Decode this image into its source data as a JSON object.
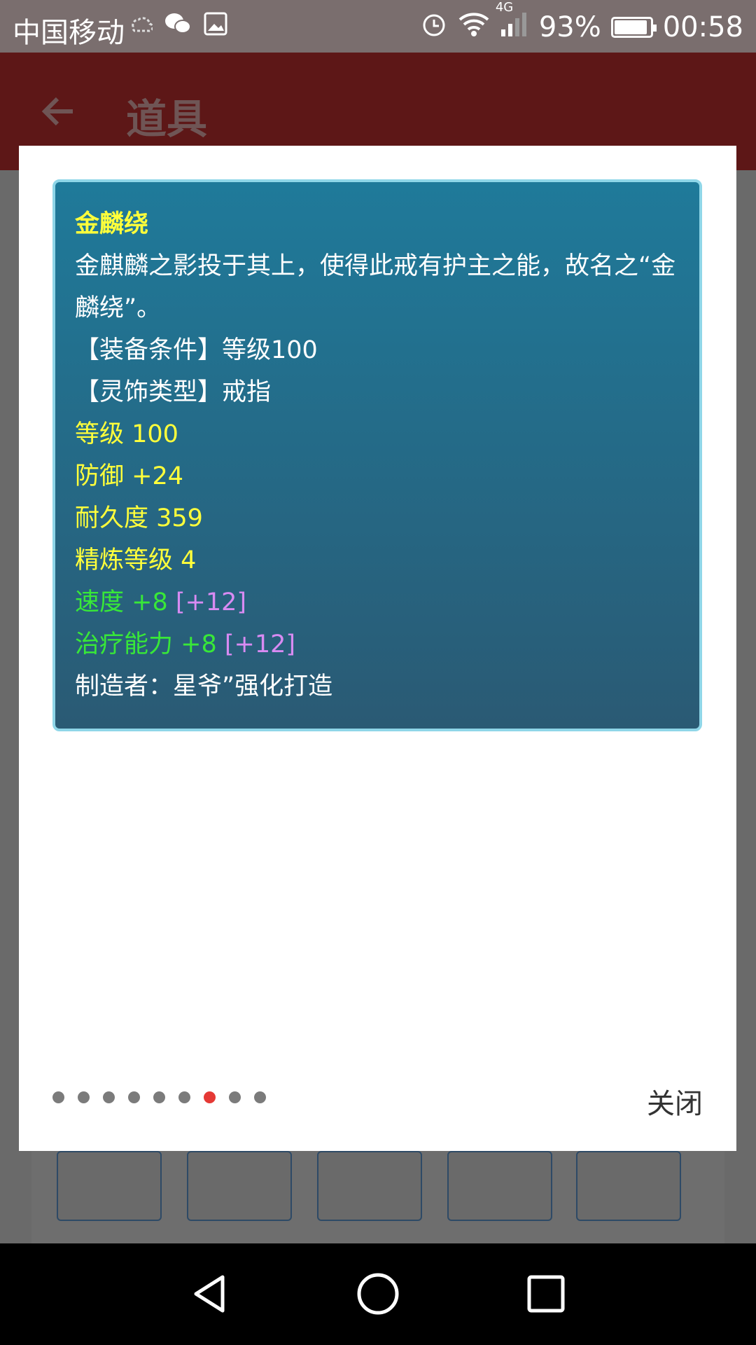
{
  "status_bar": {
    "carrier": "中国移动",
    "network": "4G",
    "battery": "93%",
    "battery_level": 0.93,
    "time": "00:58",
    "icons": [
      "weather-icon",
      "wechat-icon",
      "image-icon",
      "alarm-icon",
      "wifi-icon",
      "signal-icon",
      "battery-icon"
    ]
  },
  "app_bar": {
    "title": "道具"
  },
  "dialog": {
    "item_name": "金麟绕",
    "description": "金麒麟之影投于其上，使得此戒有护主之能，故名之“金麟绕”。",
    "equip_condition": "【装备条件】等级100",
    "accessory_type": "【灵饰类型】戒指",
    "level": "等级 100",
    "defense": "防御 +24",
    "durability": "耐久度 359",
    "refine_level": "精炼等级 4",
    "speed": "速度 +8",
    "speed_bonus": "[+12]",
    "healing": "治疗能力 +8",
    "healing_bonus": "[+12]",
    "maker": "制造者：星爷”强化打造",
    "close_label": "关闭",
    "page_count": 9,
    "active_page": 7
  },
  "colors": {
    "attr_yellow": "#ffff3b",
    "attr_green": "#38e838",
    "bonus_violet": "#d88bf2",
    "pager_active": "#e53935"
  }
}
